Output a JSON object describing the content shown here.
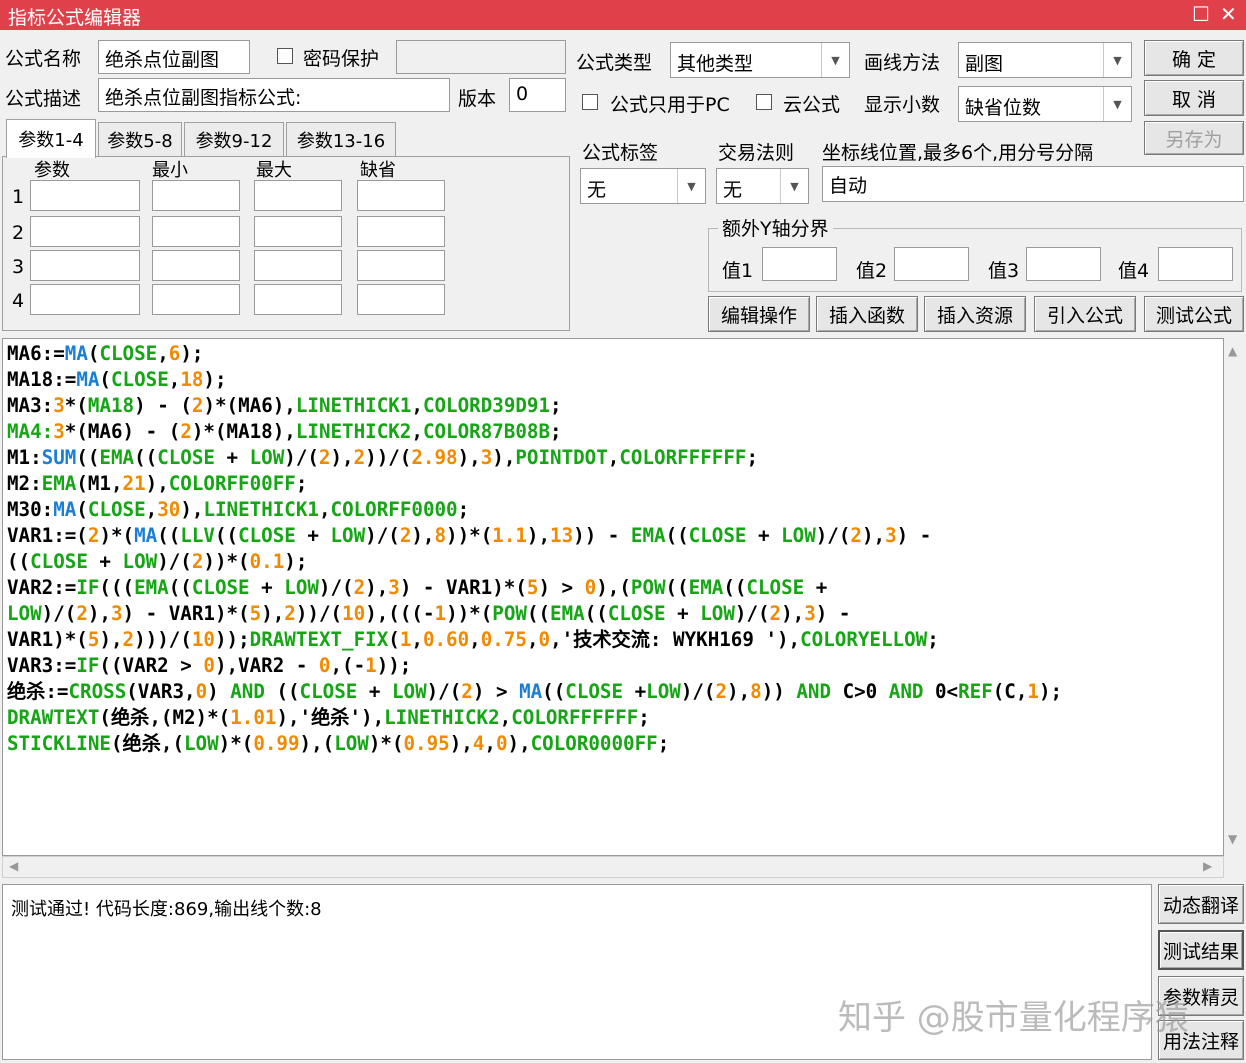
{
  "window": {
    "title": "指标公式编辑器",
    "restore_glyph": "☐",
    "close_glyph": "✕"
  },
  "form": {
    "name_label": "公式名称",
    "name_value": "绝杀点位副图",
    "password_label": "密码保护",
    "password_value": "",
    "desc_label": "公式描述",
    "desc_value": "绝杀点位副图指标公式:",
    "version_label": "版本",
    "version_value": "0",
    "type_label": "公式类型",
    "type_value": "其他类型",
    "draw_label": "画线方法",
    "draw_value": "副图",
    "pc_only_label": "公式只用于PC",
    "cloud_label": "云公式",
    "decimal_label": "显示小数",
    "decimal_value": "缺省位数",
    "tag_label": "公式标签",
    "tag_value": "无",
    "rule_label": "交易法则",
    "rule_value": "无",
    "axis_label": "坐标线位置,最多6个,用分号分隔",
    "axis_value": "自动",
    "extra_y_label": "额外Y轴分界",
    "val_labels": [
      "值1",
      "值2",
      "值3",
      "值4"
    ]
  },
  "params": {
    "tabs": [
      "参数1-4",
      "参数5-8",
      "参数9-12",
      "参数13-16"
    ],
    "headers": [
      "参数",
      "最小",
      "最大",
      "缺省"
    ],
    "rows": [
      "1",
      "2",
      "3",
      "4"
    ]
  },
  "buttons": {
    "ok": "确  定",
    "cancel": "取  消",
    "save_as": "另存为",
    "edit_ops": "编辑操作",
    "insert_func": "插入函数",
    "insert_res": "插入资源",
    "import_formula": "引入公式",
    "test_formula": "测试公式",
    "dyn_translate": "动态翻译",
    "test_result": "测试结果",
    "param_wizard": "参数精灵",
    "usage_notes": "用法注释"
  },
  "colors": {
    "keyword": "#1a7fd4",
    "number": "#f08a00",
    "green": "#15a515",
    "title_bar": "#e0404a"
  },
  "code_lines": [
    [
      [
        "MA6:=",
        ""
      ],
      [
        "MA",
        "k"
      ],
      [
        "(",
        ""
      ],
      [
        "CLOSE",
        "g"
      ],
      [
        ",",
        ""
      ],
      [
        "6",
        "n"
      ],
      [
        ");",
        ""
      ]
    ],
    [
      [
        "MA18:=",
        ""
      ],
      [
        "MA",
        "k"
      ],
      [
        "(",
        ""
      ],
      [
        "CLOSE",
        "g"
      ],
      [
        ",",
        ""
      ],
      [
        "18",
        "n"
      ],
      [
        ");",
        ""
      ]
    ],
    [
      [
        "MA3:",
        ""
      ],
      [
        "3",
        "n"
      ],
      [
        "*(",
        ""
      ],
      [
        "MA18",
        "g"
      ],
      [
        ") - (",
        ""
      ],
      [
        "2",
        "n"
      ],
      [
        ")*(MA6),",
        ""
      ],
      [
        "LINETHICK1",
        "g"
      ],
      [
        ",",
        ""
      ],
      [
        "COLORD39D91",
        "g"
      ],
      [
        ";",
        ""
      ]
    ],
    [
      [
        "MA4:",
        "g"
      ],
      [
        "3",
        "n"
      ],
      [
        "*(MA6) - (",
        ""
      ],
      [
        "2",
        "n"
      ],
      [
        ")*(MA18),",
        ""
      ],
      [
        "LINETHICK2",
        "g"
      ],
      [
        ",",
        ""
      ],
      [
        "COLOR87B08B",
        "g"
      ],
      [
        ";",
        ""
      ]
    ],
    [
      [
        "M1:",
        ""
      ],
      [
        "SUM",
        "k"
      ],
      [
        "((",
        ""
      ],
      [
        "EMA",
        "g"
      ],
      [
        "((",
        ""
      ],
      [
        "CLOSE",
        "g"
      ],
      [
        " + ",
        ""
      ],
      [
        "LOW",
        "g"
      ],
      [
        ")/(",
        ""
      ],
      [
        "2",
        "n"
      ],
      [
        "),",
        ""
      ],
      [
        "2",
        "n"
      ],
      [
        "))/(",
        ""
      ],
      [
        "2.98",
        "n"
      ],
      [
        "),",
        ""
      ],
      [
        "3",
        "n"
      ],
      [
        "),",
        ""
      ],
      [
        "POINTDOT",
        "g"
      ],
      [
        ",",
        ""
      ],
      [
        "COLORFFFFFF",
        "g"
      ],
      [
        ";",
        ""
      ]
    ],
    [
      [
        "M2:",
        ""
      ],
      [
        "EMA",
        "g"
      ],
      [
        "(M1,",
        ""
      ],
      [
        "21",
        "n"
      ],
      [
        "),",
        ""
      ],
      [
        "COLORFF00FF",
        "g"
      ],
      [
        ";",
        ""
      ]
    ],
    [
      [
        "M30:",
        ""
      ],
      [
        "MA",
        "k"
      ],
      [
        "(",
        ""
      ],
      [
        "CLOSE",
        "g"
      ],
      [
        ",",
        ""
      ],
      [
        "30",
        "n"
      ],
      [
        "),",
        ""
      ],
      [
        "LINETHICK1",
        "g"
      ],
      [
        ",",
        ""
      ],
      [
        "COLORFF0000",
        "g"
      ],
      [
        ";",
        ""
      ]
    ],
    [
      [
        "VAR1:=(",
        ""
      ],
      [
        "2",
        "n"
      ],
      [
        ")*(",
        ""
      ],
      [
        "MA",
        "k"
      ],
      [
        "((",
        ""
      ],
      [
        "LLV",
        "g"
      ],
      [
        "((",
        ""
      ],
      [
        "CLOSE",
        "g"
      ],
      [
        " + ",
        ""
      ],
      [
        "LOW",
        "g"
      ],
      [
        ")/(",
        ""
      ],
      [
        "2",
        "n"
      ],
      [
        "),",
        ""
      ],
      [
        "8",
        "n"
      ],
      [
        "))*(",
        ""
      ],
      [
        "1.1",
        "n"
      ],
      [
        "),",
        ""
      ],
      [
        "13",
        "n"
      ],
      [
        ")) - ",
        ""
      ],
      [
        "EMA",
        "g"
      ],
      [
        "((",
        ""
      ],
      [
        "CLOSE",
        "g"
      ],
      [
        " + ",
        ""
      ],
      [
        "LOW",
        "g"
      ],
      [
        ")/(",
        ""
      ],
      [
        "2",
        "n"
      ],
      [
        "),",
        ""
      ],
      [
        "3",
        "n"
      ],
      [
        ") -",
        ""
      ]
    ],
    [
      [
        "((",
        ""
      ],
      [
        "CLOSE",
        "g"
      ],
      [
        " + ",
        ""
      ],
      [
        "LOW",
        "g"
      ],
      [
        ")/(",
        ""
      ],
      [
        "2",
        "n"
      ],
      [
        "))*(",
        ""
      ],
      [
        "0.1",
        "n"
      ],
      [
        ");",
        ""
      ]
    ],
    [
      [
        "VAR2:=",
        ""
      ],
      [
        "IF",
        "g"
      ],
      [
        "(((",
        ""
      ],
      [
        "EMA",
        "g"
      ],
      [
        "((",
        ""
      ],
      [
        "CLOSE",
        "g"
      ],
      [
        " + ",
        ""
      ],
      [
        "LOW",
        "g"
      ],
      [
        ")/(",
        ""
      ],
      [
        "2",
        "n"
      ],
      [
        "),",
        ""
      ],
      [
        "3",
        "n"
      ],
      [
        ") - VAR1)*(",
        ""
      ],
      [
        "5",
        "n"
      ],
      [
        ") > ",
        ""
      ],
      [
        "0",
        "n"
      ],
      [
        "),(",
        ""
      ],
      [
        "POW",
        "g"
      ],
      [
        "((",
        ""
      ],
      [
        "EMA",
        "g"
      ],
      [
        "((",
        ""
      ],
      [
        "CLOSE",
        "g"
      ],
      [
        " +",
        ""
      ]
    ],
    [
      [
        "LOW",
        "g"
      ],
      [
        ")/(",
        ""
      ],
      [
        "2",
        "n"
      ],
      [
        "),",
        ""
      ],
      [
        "3",
        "n"
      ],
      [
        ") - VAR1)*(",
        ""
      ],
      [
        "5",
        "n"
      ],
      [
        "),",
        ""
      ],
      [
        "2",
        "n"
      ],
      [
        "))/(",
        ""
      ],
      [
        "10",
        "n"
      ],
      [
        "),(((-",
        ""
      ],
      [
        "1",
        "n"
      ],
      [
        "))*(",
        ""
      ],
      [
        "POW",
        "g"
      ],
      [
        "((",
        ""
      ],
      [
        "EMA",
        "g"
      ],
      [
        "((",
        ""
      ],
      [
        "CLOSE",
        "g"
      ],
      [
        " + ",
        ""
      ],
      [
        "LOW",
        "g"
      ],
      [
        ")/(",
        ""
      ],
      [
        "2",
        "n"
      ],
      [
        "),",
        ""
      ],
      [
        "3",
        "n"
      ],
      [
        ") -",
        ""
      ]
    ],
    [
      [
        "VAR1)*(",
        ""
      ],
      [
        "5",
        "n"
      ],
      [
        "),",
        ""
      ],
      [
        "2",
        "n"
      ],
      [
        ")))/(",
        ""
      ],
      [
        "10",
        "n"
      ],
      [
        "));",
        ""
      ],
      [
        "DRAWTEXT_FIX",
        "g"
      ],
      [
        "(",
        ""
      ],
      [
        "1",
        "n"
      ],
      [
        ",",
        ""
      ],
      [
        "0.60",
        "n"
      ],
      [
        ",",
        ""
      ],
      [
        "0.75",
        "n"
      ],
      [
        ",",
        ""
      ],
      [
        "0",
        "n"
      ],
      [
        ",'技术交流: WYKH169 '),",
        ""
      ],
      [
        "COLORYELLOW",
        "g"
      ],
      [
        ";",
        ""
      ]
    ],
    [
      [
        "VAR3:=",
        ""
      ],
      [
        "IF",
        "g"
      ],
      [
        "((VAR2 > ",
        ""
      ],
      [
        "0",
        "n"
      ],
      [
        "),VAR2 - ",
        ""
      ],
      [
        "0",
        "n"
      ],
      [
        ",(-",
        ""
      ],
      [
        "1",
        "n"
      ],
      [
        "));",
        ""
      ]
    ],
    [
      [
        "绝杀:=",
        ""
      ],
      [
        "CROSS",
        "g"
      ],
      [
        "(VAR3,",
        ""
      ],
      [
        "0",
        "n"
      ],
      [
        ") ",
        ""
      ],
      [
        "AND",
        "g"
      ],
      [
        " ((",
        ""
      ],
      [
        "CLOSE",
        "g"
      ],
      [
        " + ",
        ""
      ],
      [
        "LOW",
        "g"
      ],
      [
        ")/(",
        ""
      ],
      [
        "2",
        "n"
      ],
      [
        ") > ",
        ""
      ],
      [
        "MA",
        "k"
      ],
      [
        "((",
        ""
      ],
      [
        "CLOSE",
        "g"
      ],
      [
        " +",
        ""
      ],
      [
        "LOW",
        "g"
      ],
      [
        ")/(",
        ""
      ],
      [
        "2",
        "n"
      ],
      [
        "),",
        ""
      ],
      [
        "8",
        "n"
      ],
      [
        ")) ",
        ""
      ],
      [
        "AND",
        "g"
      ],
      [
        " C>0 ",
        ""
      ],
      [
        "AND",
        "g"
      ],
      [
        " 0<",
        ""
      ],
      [
        "REF",
        "g"
      ],
      [
        "(C,",
        ""
      ],
      [
        "1",
        "n"
      ],
      [
        ");",
        ""
      ]
    ],
    [
      [
        "DRAWTEXT",
        "g"
      ],
      [
        "(绝杀,(M2)*(",
        ""
      ],
      [
        "1.01",
        "n"
      ],
      [
        "),'绝杀'),",
        ""
      ],
      [
        "LINETHICK2",
        "g"
      ],
      [
        ",",
        ""
      ],
      [
        "COLORFFFFFF",
        "g"
      ],
      [
        ";",
        ""
      ]
    ],
    [
      [
        "STICKLINE",
        "g"
      ],
      [
        "(绝杀,(",
        ""
      ],
      [
        "LOW",
        "g"
      ],
      [
        ")*(",
        ""
      ],
      [
        "0.99",
        "n"
      ],
      [
        "),(",
        ""
      ],
      [
        "LOW",
        "g"
      ],
      [
        ")*(",
        ""
      ],
      [
        "0.95",
        "n"
      ],
      [
        "),",
        ""
      ],
      [
        "4",
        "n"
      ],
      [
        ",",
        ""
      ],
      [
        "0",
        "n"
      ],
      [
        "),",
        ""
      ],
      [
        "COLOR0000FF",
        "g"
      ],
      [
        ";",
        ""
      ]
    ]
  ],
  "output_text": "测试通过! 代码长度:869,输出线个数:8",
  "watermark": "知乎 @股市量化程序猿"
}
